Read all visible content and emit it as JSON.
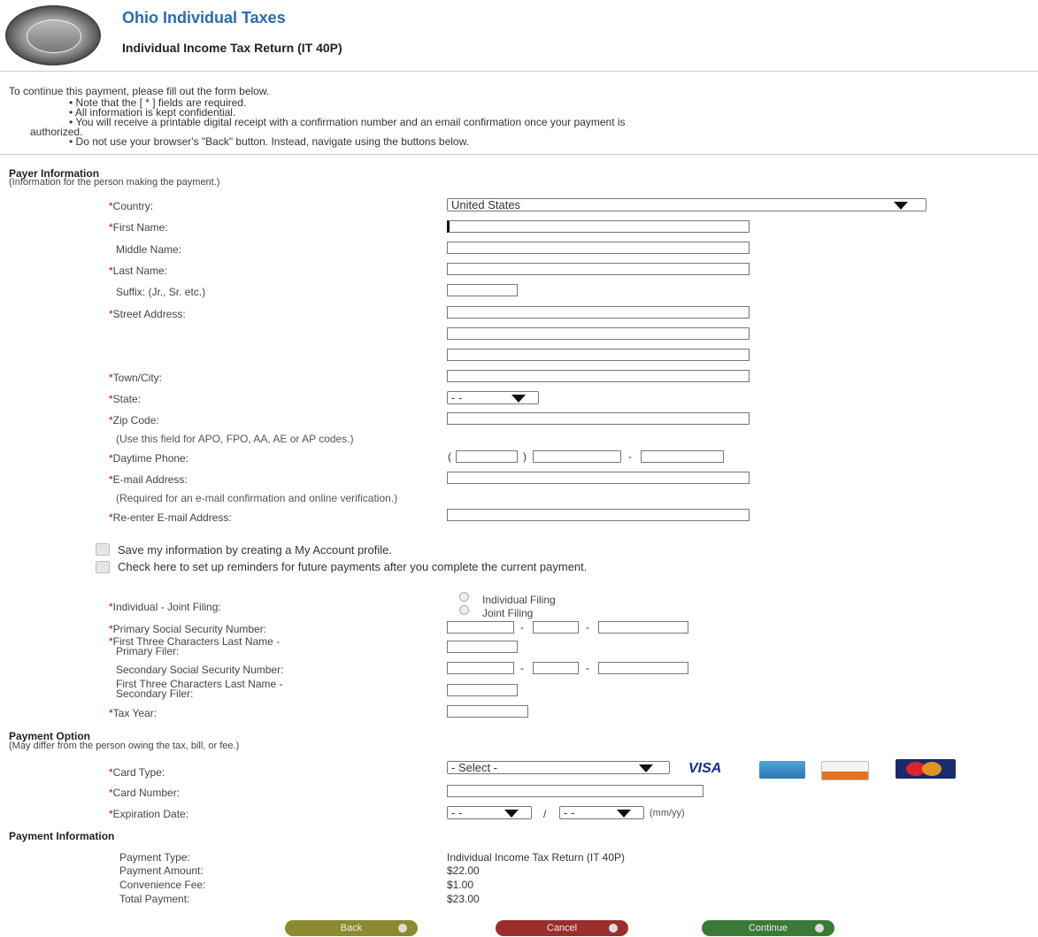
{
  "header": {
    "title": "Ohio Individual Taxes",
    "subtitle": "Individual Income Tax Return (IT 40P)"
  },
  "intro": {
    "text": "To continue this payment, please fill out the form below.",
    "bullets": [
      "• Note that the [ * ] fields are required.",
      "• All information is kept confidential.",
      "• You will receive a printable digital receipt with a confirmation number and an email confirmation once your payment is",
      "authorized.",
      "• Do not use your browser's \"Back\" button. Instead, navigate using the buttons below."
    ]
  },
  "payer": {
    "title": "Payer Information",
    "subtitle": "(Information for the person making the payment.)",
    "country_label": "Country:",
    "country_value": "United States",
    "first_name_label": "First Name:",
    "middle_name_label": "Middle Name:",
    "last_name_label": "Last Name:",
    "suffix_label": "Suffix: (Jr., Sr. etc.)",
    "street_label": "Street Address:",
    "town_label": "Town/City:",
    "state_label": "State:",
    "state_value": "- -",
    "zip_label": "Zip Code:",
    "zip_hint": "(Use this field for APO, FPO, AA, AE or AP codes.)",
    "phone_label": "Daytime Phone:",
    "phone_open": "(",
    "phone_close": ")",
    "phone_dash": "-",
    "email_label": "E-mail Address:",
    "email_hint": "(Required for an e-mail confirmation and online verification.)",
    "reemail_label": "Re-enter E-mail Address:"
  },
  "options": {
    "save_profile": "Save my information by creating a My Account profile.",
    "reminders": "Check here to set up reminders for future payments after you complete the current payment."
  },
  "filing": {
    "filing_label": "Individual - Joint Filing:",
    "individual": "Individual Filing",
    "joint": "Joint Filing",
    "primary_ssn_label": "Primary Social Security Number:",
    "primary_name_label_1": "First Three Characters Last Name -",
    "primary_name_label_2": "Primary Filer:",
    "secondary_ssn_label": "Secondary Social Security Number:",
    "secondary_name_label_1": "First Three Characters Last Name -",
    "secondary_name_label_2": "Secondary Filer:",
    "tax_year_label": "Tax Year:",
    "dash": "-"
  },
  "payment_option": {
    "title": "Payment Option",
    "subtitle": "(May differ from the person owing the tax, bill, or fee.)",
    "card_type_label": "Card Type:",
    "card_type_value": "- Select -",
    "visa": "VISA",
    "card_number_label": "Card Number:",
    "expiration_label": "Expiration Date:",
    "exp_month": "- -",
    "exp_year": "- -",
    "exp_slash": "/",
    "exp_format": "(mm/yy)"
  },
  "payment_info": {
    "title": "Payment Information",
    "rows": [
      {
        "label": "Payment Type:",
        "value": "Individual Income Tax Return (IT 40P)"
      },
      {
        "label": "Payment Amount:",
        "value": "$22.00"
      },
      {
        "label": "Convenience Fee:",
        "value": "$1.00"
      },
      {
        "label": "Total Payment:",
        "value": "$23.00"
      }
    ]
  },
  "buttons": {
    "back": "Back",
    "cancel": "Cancel",
    "continue": "Continue"
  },
  "required_mark": "*",
  "colors": {
    "title_blue": "#2a6bb5",
    "back_olive": "#8c8a2e",
    "cancel_red": "#9b2d2d",
    "continue_green": "#3b7a36"
  }
}
